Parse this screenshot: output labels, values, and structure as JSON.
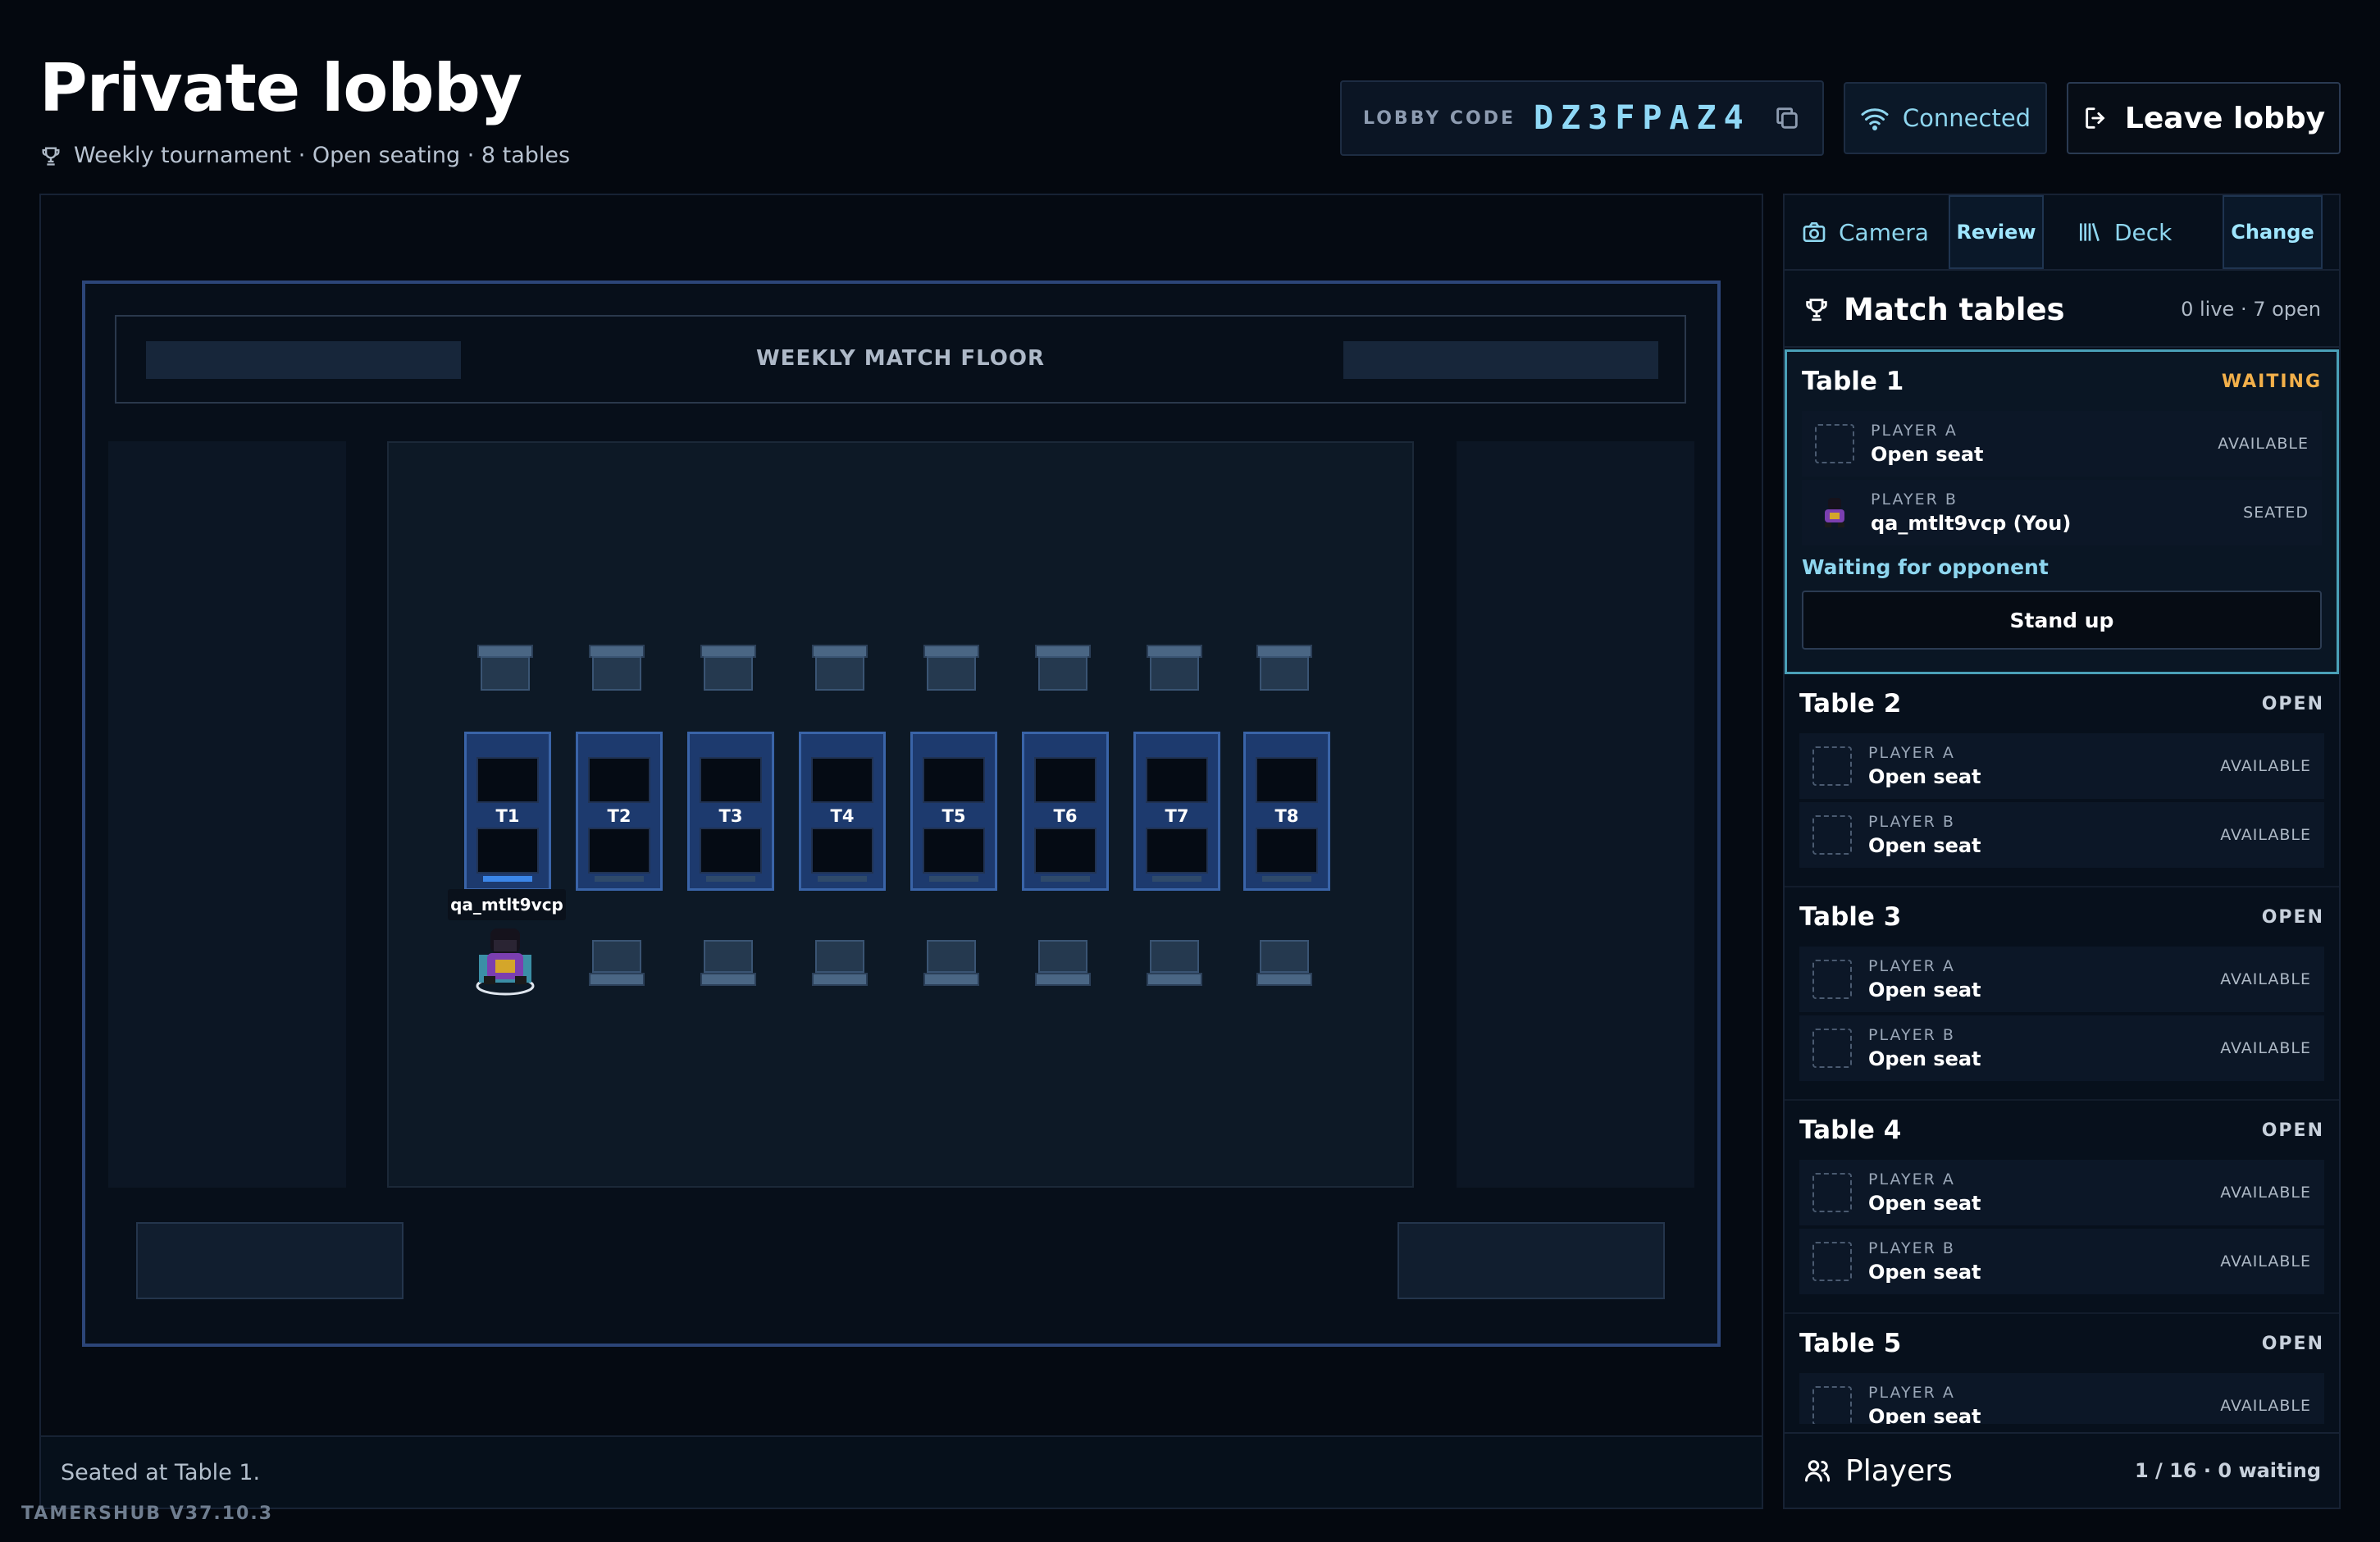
{
  "header": {
    "title": "Private lobby",
    "subtitle": "Weekly tournament · Open seating · 8 tables",
    "lobby_code_label": "LOBBY CODE",
    "lobby_code": "DZ3FPAZ4",
    "connection": "Connected",
    "leave_label": "Leave lobby"
  },
  "map": {
    "banner_title": "WEEKLY MATCH FLOOR",
    "tables": [
      {
        "label": "T1",
        "active": true
      },
      {
        "label": "T2",
        "active": false
      },
      {
        "label": "T3",
        "active": false
      },
      {
        "label": "T4",
        "active": false
      },
      {
        "label": "T5",
        "active": false
      },
      {
        "label": "T6",
        "active": false
      },
      {
        "label": "T7",
        "active": false
      },
      {
        "label": "T8",
        "active": false
      }
    ],
    "player_name": "qa_mtlt9vcp",
    "status": "Seated at Table 1.",
    "version": "TAMERSHUB V37.10.3"
  },
  "panel": {
    "tabs": {
      "camera": "Camera",
      "review": "Review",
      "deck": "Deck",
      "change": "Change"
    },
    "match_title": "Match tables",
    "match_summary": "0 live · 7 open",
    "tables": [
      {
        "name": "Table 1",
        "state": "WAITING",
        "slots": [
          {
            "role": "PLAYER A",
            "who": "Open seat",
            "status": "AVAILABLE",
            "occupied": false
          },
          {
            "role": "PLAYER B",
            "who": "qa_mtlt9vcp (You)",
            "status": "SEATED",
            "occupied": true
          }
        ],
        "message": "Waiting for opponent",
        "action": "Stand up"
      },
      {
        "name": "Table 2",
        "state": "OPEN",
        "slots": [
          {
            "role": "PLAYER A",
            "who": "Open seat",
            "status": "AVAILABLE",
            "occupied": false
          },
          {
            "role": "PLAYER B",
            "who": "Open seat",
            "status": "AVAILABLE",
            "occupied": false
          }
        ]
      },
      {
        "name": "Table 3",
        "state": "OPEN",
        "slots": [
          {
            "role": "PLAYER A",
            "who": "Open seat",
            "status": "AVAILABLE",
            "occupied": false
          },
          {
            "role": "PLAYER B",
            "who": "Open seat",
            "status": "AVAILABLE",
            "occupied": false
          }
        ]
      },
      {
        "name": "Table 4",
        "state": "OPEN",
        "slots": [
          {
            "role": "PLAYER A",
            "who": "Open seat",
            "status": "AVAILABLE",
            "occupied": false
          },
          {
            "role": "PLAYER B",
            "who": "Open seat",
            "status": "AVAILABLE",
            "occupied": false
          }
        ]
      },
      {
        "name": "Table 5",
        "state": "OPEN",
        "slots": [
          {
            "role": "PLAYER A",
            "who": "Open seat",
            "status": "AVAILABLE",
            "occupied": false
          }
        ]
      }
    ],
    "players_label": "Players",
    "players_summary": "1 / 16 · 0 waiting"
  },
  "colors": {
    "background": "#04080f",
    "accent": "#8ed6ef",
    "waiting": "#f3b04a",
    "table": "#1d3a6e"
  },
  "icons": {
    "subtitle": "trophy-icon",
    "copy": "copy-icon",
    "connection": "wifi-icon",
    "leave": "exit-icon",
    "camera": "camera-icon",
    "deck": "library-icon",
    "match": "trophy-icon",
    "players": "users-icon"
  }
}
